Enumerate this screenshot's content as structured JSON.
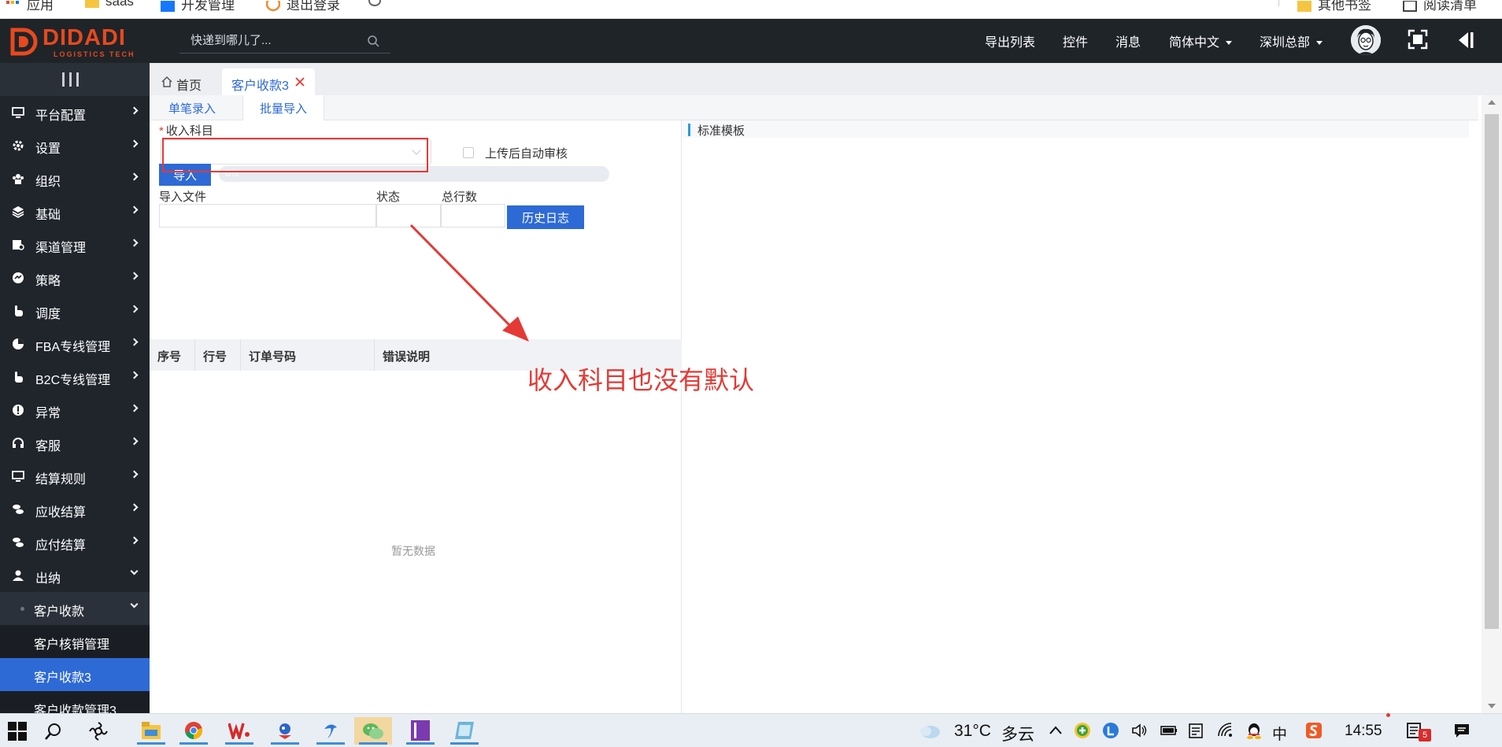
{
  "bookmarks": [
    "应用",
    "saas",
    "开发管理",
    "退出登录",
    "其他书签",
    "阅读清单"
  ],
  "brand": {
    "name": "DIDADI",
    "sub": "LOGISTICS TECH",
    "color": "#e8491d"
  },
  "header": {
    "search_placeholder": "快递到哪儿了...",
    "nav": [
      {
        "label": "导出列表"
      },
      {
        "label": "控件"
      },
      {
        "label": "消息"
      },
      {
        "label": "简体中文",
        "dropdown": true
      },
      {
        "label": "深圳总部",
        "dropdown": true
      }
    ]
  },
  "sidebar": {
    "items": [
      {
        "label": "平台配置",
        "icon": "monitor-icon"
      },
      {
        "label": "设置",
        "icon": "gear-icon"
      },
      {
        "label": "组织",
        "icon": "org-icon"
      },
      {
        "label": "基础",
        "icon": "layers-icon"
      },
      {
        "label": "渠道管理",
        "icon": "channel-icon"
      },
      {
        "label": "策略",
        "icon": "strategy-icon"
      },
      {
        "label": "调度",
        "icon": "hand-icon"
      },
      {
        "label": "FBA专线管理",
        "icon": "pie-icon"
      },
      {
        "label": "B2C专线管理",
        "icon": "hand-icon"
      },
      {
        "label": "异常",
        "icon": "alert-icon"
      },
      {
        "label": "客服",
        "icon": "headset-icon"
      },
      {
        "label": "结算规则",
        "icon": "monitor-icon"
      },
      {
        "label": "应收结算",
        "icon": "coins-icon"
      },
      {
        "label": "应付结算",
        "icon": "coins-icon"
      },
      {
        "label": "出纳",
        "icon": "user-icon",
        "expanded": true
      }
    ],
    "submenu": {
      "group": "客户收款",
      "children": [
        "客户核销管理",
        "客户收款3",
        "客户收款管理3"
      ],
      "active": "客户收款3"
    }
  },
  "tabs": {
    "home": "首页",
    "active": "客户收款3"
  },
  "subtabs": [
    "单笔录入",
    "批量导入"
  ],
  "form": {
    "subject_label": "收入科目",
    "required_mark": "*",
    "subject_value": "",
    "auto_audit_label": "上传后自动审核",
    "auto_audit_checked": false,
    "import_button": "导入",
    "progress": {
      "text": "0%",
      "value": 0
    },
    "file_label": "导入文件",
    "status_label": "状态",
    "rows_label": "总行数",
    "history_button": "历史日志"
  },
  "grid": {
    "columns": [
      "序号",
      "行号",
      "订单号码",
      "错误说明"
    ],
    "rows": [],
    "empty_text": "暂无数据"
  },
  "right_panel": {
    "title": "标准模板"
  },
  "annotation": {
    "text": "收入科目也没有默认",
    "color": "#e53935"
  },
  "taskbar": {
    "apps": [
      "file-explorer-icon",
      "chrome-icon",
      "wps-icon",
      "bird-icon",
      "arrow-app-icon",
      "wechat-icon",
      "rp-icon",
      "notepad-icon"
    ],
    "weather_temp": "31°C",
    "weather_desc": "多云",
    "ime": "中",
    "time": "14:55",
    "notification_count": "5"
  },
  "colors": {
    "accent": "#2e6ad5",
    "header_bg": "#1f2429",
    "sidebar_bg": "#20252c"
  }
}
